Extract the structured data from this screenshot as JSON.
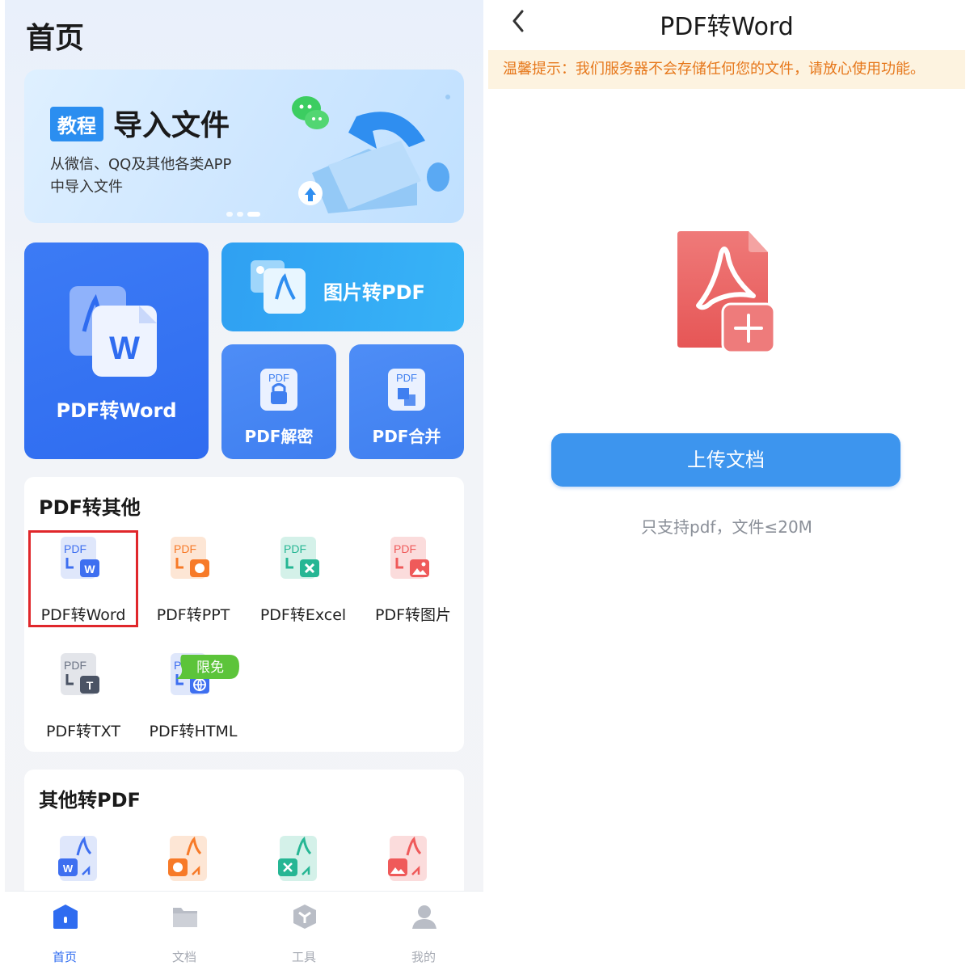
{
  "left": {
    "page_title": "首页",
    "banner": {
      "tag": "教程",
      "title": "导入文件",
      "subtitle_line1": "从微信、QQ及其他各类APP",
      "subtitle_line2": "中导入文件"
    },
    "big_cards": {
      "pdf_to_word": "PDF转Word",
      "image_to_pdf": "图片转PDF",
      "pdf_decrypt": "PDF解密",
      "pdf_merge": "PDF合并"
    },
    "section_pdf_to_other": {
      "title": "PDF转其他",
      "items": [
        {
          "label": "PDF转Word",
          "icon": "pdf-to-word-icon",
          "color": "#3e6ff0"
        },
        {
          "label": "PDF转PPT",
          "icon": "pdf-to-ppt-icon",
          "color": "#f77a28"
        },
        {
          "label": "PDF转Excel",
          "icon": "pdf-to-excel-icon",
          "color": "#26b694"
        },
        {
          "label": "PDF转图片",
          "icon": "pdf-to-image-icon",
          "color": "#ef5a5a"
        },
        {
          "label": "PDF转TXT",
          "icon": "pdf-to-txt-icon",
          "color": "#4a5364"
        },
        {
          "label": "PDF转HTML",
          "icon": "pdf-to-html-icon",
          "color": "#3e6ff0"
        }
      ],
      "free_badge": "限免"
    },
    "section_other_to_pdf": {
      "title": "其他转PDF"
    },
    "tabbar": [
      {
        "label": "首页",
        "icon": "home-icon",
        "active": true
      },
      {
        "label": "文档",
        "icon": "folder-icon",
        "active": false
      },
      {
        "label": "工具",
        "icon": "tools-icon",
        "active": false
      },
      {
        "label": "我的",
        "icon": "user-icon",
        "active": false
      }
    ]
  },
  "right": {
    "title": "PDF转Word",
    "notice": "温馨提示：我们服务器不会存储任何您的文件，请放心使用功能。",
    "upload_button": "上传文档",
    "hint": "只支持pdf，文件≤20M"
  },
  "colors": {
    "primary_blue": "#2f6cf0",
    "upload_blue": "#3d95ee",
    "notice_bg": "#fdf3e0",
    "notice_text": "#e6771a",
    "selected_outline": "#e0272b",
    "badge_green": "#5cc43a"
  },
  "icons": {
    "word_stack_label": "W",
    "pdf_small_label": "PDF"
  }
}
